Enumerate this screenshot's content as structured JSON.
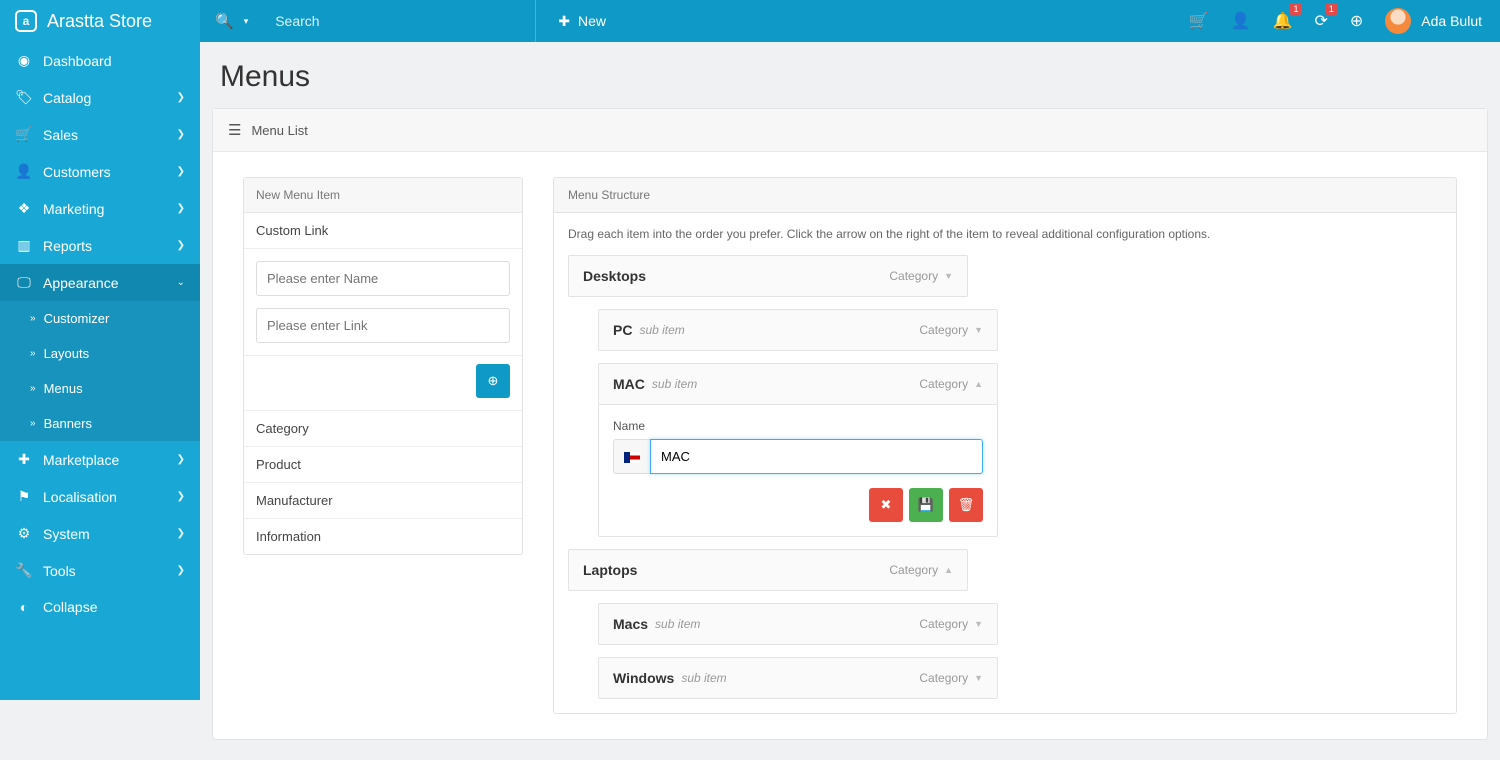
{
  "brand": "Arastta Store",
  "topbar": {
    "search_placeholder": "Search",
    "new_label": "New",
    "notif_badge": "1",
    "refresh_badge": "1",
    "user_name": "Ada Bulut"
  },
  "sidebar": {
    "items": [
      {
        "label": "Dashboard",
        "icon": "◔"
      },
      {
        "label": "Catalog",
        "icon": "🏷"
      },
      {
        "label": "Sales",
        "icon": "🛒"
      },
      {
        "label": "Customers",
        "icon": "👤"
      },
      {
        "label": "Marketing",
        "icon": "❖"
      },
      {
        "label": "Reports",
        "icon": "▮"
      },
      {
        "label": "Appearance",
        "icon": "🖵"
      },
      {
        "label": "Marketplace",
        "icon": "✚"
      },
      {
        "label": "Localisation",
        "icon": "⚑"
      },
      {
        "label": "System",
        "icon": "⚙"
      },
      {
        "label": "Tools",
        "icon": "🔧"
      },
      {
        "label": "Collapse",
        "icon": "◐"
      }
    ],
    "appearance_children": [
      {
        "label": "Customizer"
      },
      {
        "label": "Layouts"
      },
      {
        "label": "Menus"
      },
      {
        "label": "Banners"
      }
    ]
  },
  "page": {
    "title": "Menus",
    "panel_title": "Menu List"
  },
  "new_menu": {
    "header": "New Menu Item",
    "custom_link_label": "Custom Link",
    "name_placeholder": "Please enter Name",
    "link_placeholder": "Please enter Link",
    "tabs": {
      "category": "Category",
      "product": "Product",
      "manufacturer": "Manufacturer",
      "information": "Information"
    }
  },
  "structure": {
    "header": "Menu Structure",
    "help": "Drag each item into the order you prefer. Click the arrow on the right of the item to reveal additional configuration options.",
    "subitem_text": "sub item",
    "type_category": "Category",
    "name_field_label": "Name",
    "items": {
      "desktops": {
        "label": "Desktops"
      },
      "pc": {
        "label": "PC"
      },
      "mac": {
        "label": "MAC",
        "name_value": "MAC"
      },
      "laptops": {
        "label": "Laptops"
      },
      "macs": {
        "label": "Macs"
      },
      "windows": {
        "label": "Windows"
      }
    }
  }
}
